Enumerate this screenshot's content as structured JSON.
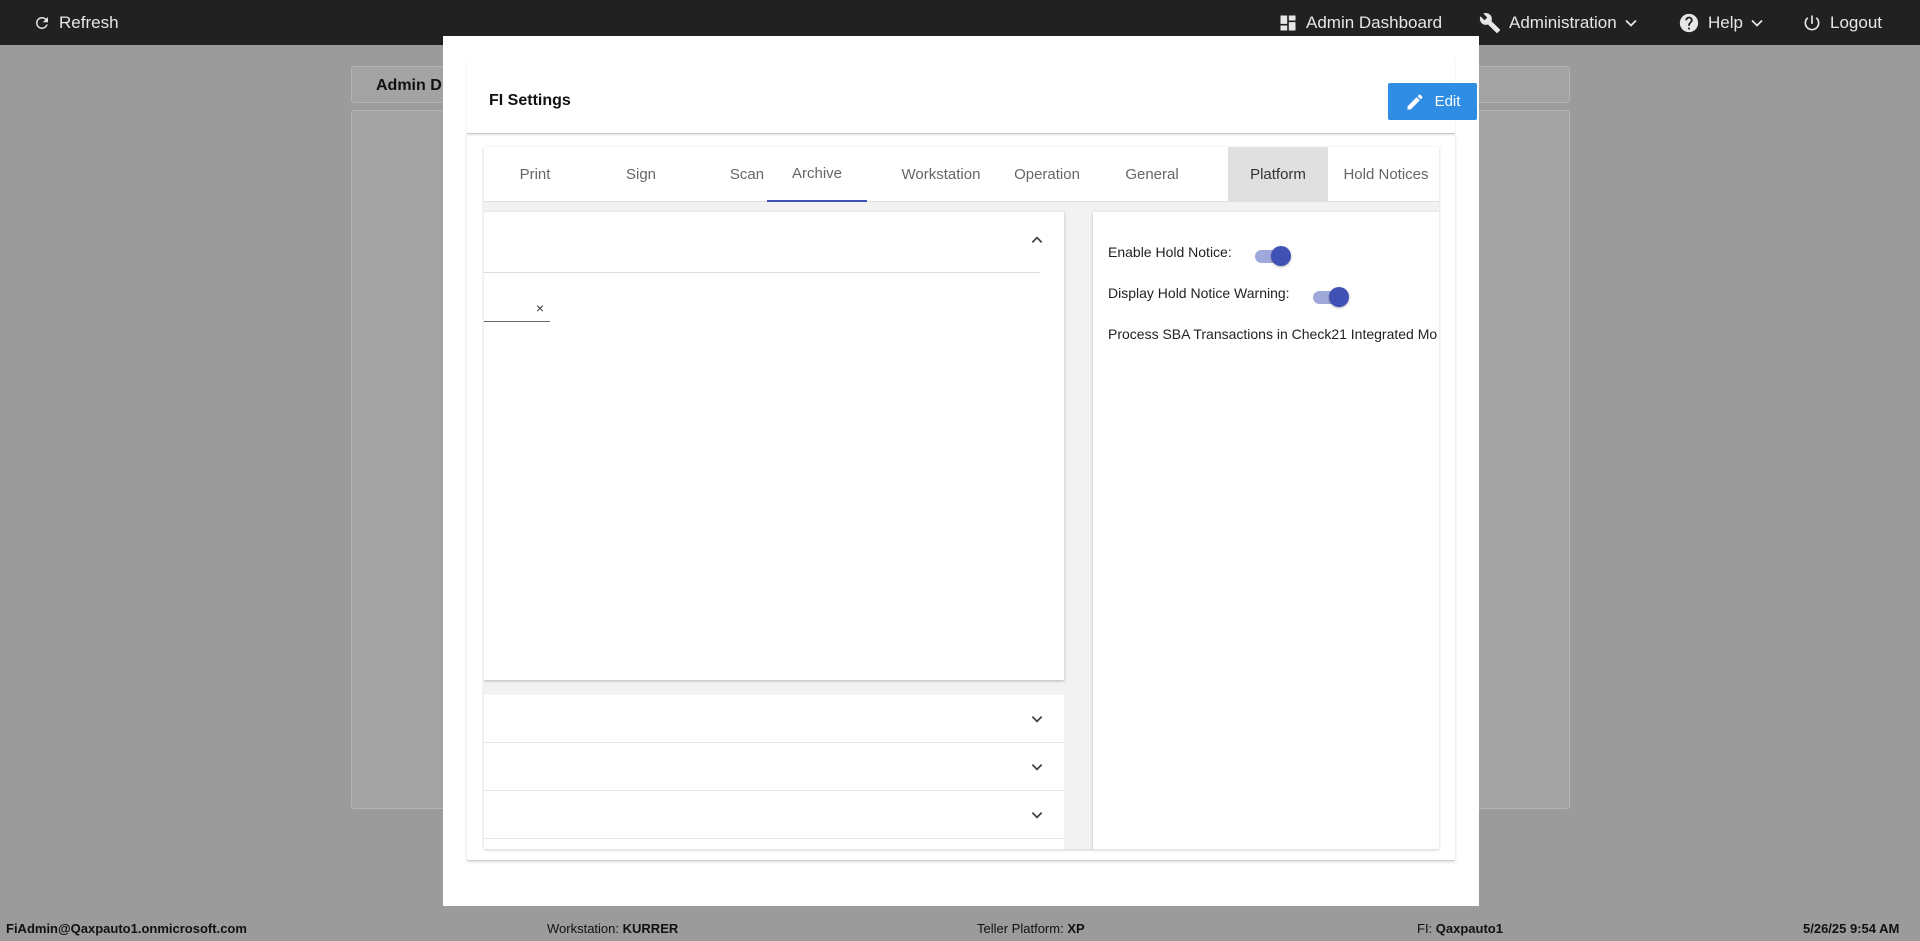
{
  "topbar": {
    "refresh": "Refresh",
    "admin_dashboard": "Admin Dashboard",
    "administration": "Administration",
    "help": "Help",
    "logout": "Logout"
  },
  "background": {
    "header_title": "Admin D"
  },
  "modal": {
    "title": "FI Settings",
    "edit_label": "Edit",
    "tabs": [
      "Print",
      "Sign",
      "Scan",
      "Archive",
      "Workstation",
      "Operation",
      "General",
      "Platform",
      "Hold Notices"
    ],
    "active_tab": "Archive",
    "highlighted_tab": "Platform",
    "clear_icon": "×",
    "settings": {
      "enable_hold_notice": {
        "label": "Enable Hold Notice:",
        "on": true
      },
      "display_hold_notice_warning": {
        "label": "Display Hold Notice Warning:",
        "on": true
      },
      "process_sba": {
        "label": "Process SBA Transactions in Check21 Integrated Mo"
      }
    }
  },
  "footer": {
    "user": "FiAdmin@Qaxpauto1.onmicrosoft.com",
    "workstation_label": "Workstation:",
    "workstation_value": "KURRER",
    "platform_label": "Teller Platform:",
    "platform_value": "XP",
    "fi_label": "FI:",
    "fi_value": "Qaxpauto1",
    "datetime": "5/26/25 9:54 AM"
  },
  "colors": {
    "accent": "#3f51b5",
    "edit_button": "#2f8de4",
    "topbar": "#212121"
  }
}
